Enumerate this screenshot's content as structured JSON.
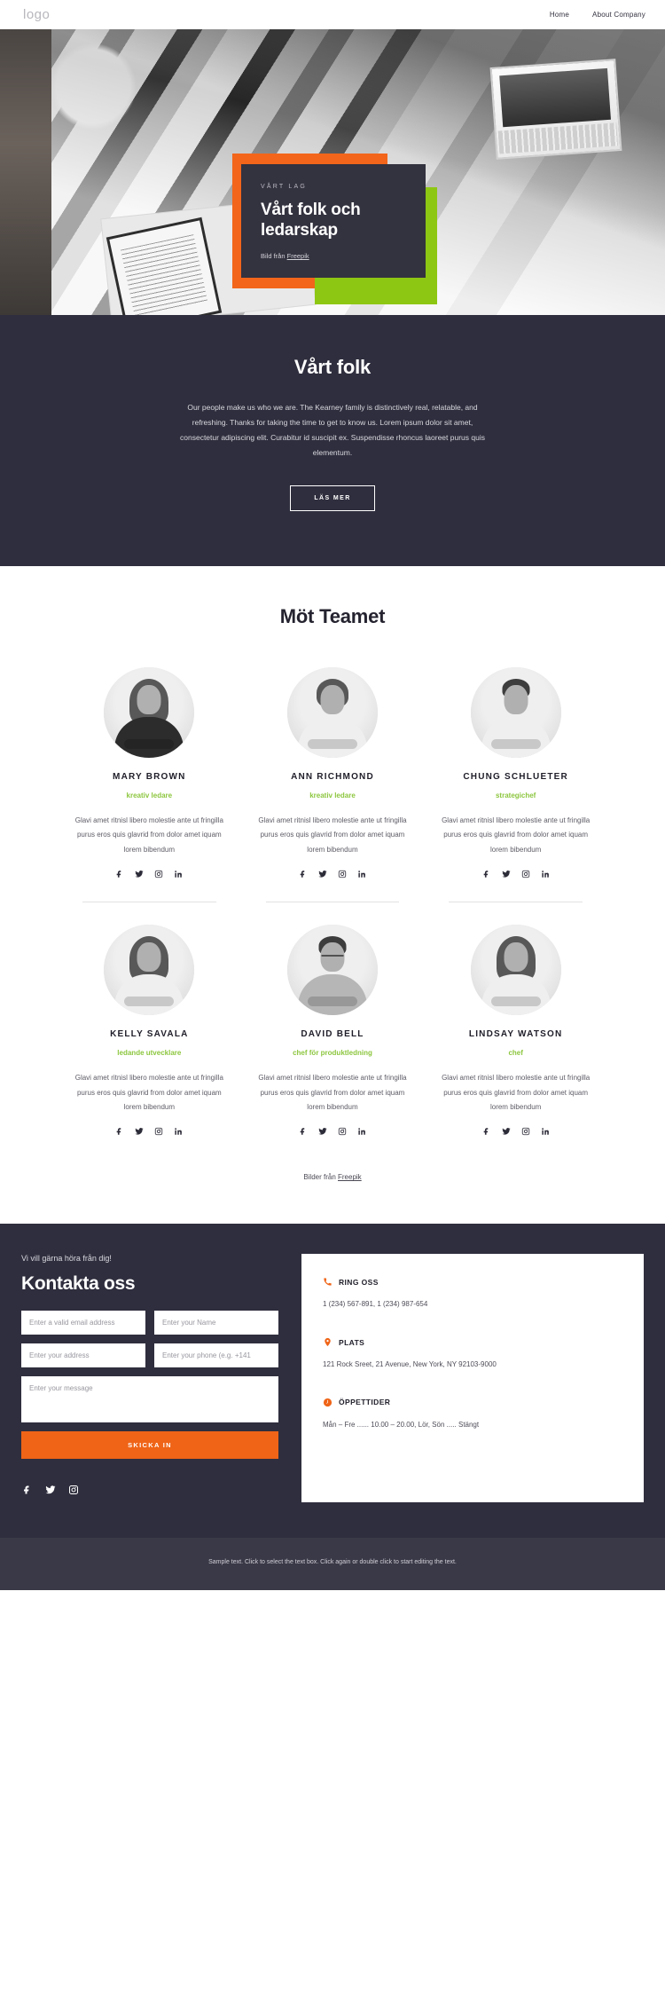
{
  "header": {
    "logo": "logo",
    "nav": [
      {
        "label": "Home"
      },
      {
        "label": "About Company"
      }
    ]
  },
  "hero": {
    "eyebrow": "VÅRT LAG",
    "title": "Vårt folk och ledarskap",
    "caption_prefix": "Bild från ",
    "caption_link": "Freepik",
    "accent_orange": "#f2651a",
    "accent_green": "#8ec713",
    "card_bg": "#33323f"
  },
  "intro": {
    "title": "Vårt folk",
    "text": "Our people make us who we are. The Kearney family is distinctively real, relatable, and refreshing. Thanks for taking the time to get to know us. Lorem ipsum dolor sit amet, consectetur adipiscing elit. Curabitur id suscipit ex. Suspendisse rhoncus laoreet purus quis elementum.",
    "button": "LÄS MER"
  },
  "team": {
    "title": "Möt Teamet",
    "role_color": "#8cc63e",
    "bio": "Glavi amet ritnisl libero molestie ante ut fringilla purus eros quis glavrid from dolor amet iquam lorem bibendum",
    "members": [
      {
        "name": "MARY BROWN",
        "role": "kreativ ledare"
      },
      {
        "name": "ANN RICHMOND",
        "role": "kreativ ledare"
      },
      {
        "name": "CHUNG SCHLUETER",
        "role": "strategichef"
      },
      {
        "name": "KELLY SAVALA",
        "role": "ledande utvecklare"
      },
      {
        "name": "DAVID BELL",
        "role": "chef för produktledning"
      },
      {
        "name": "LINDSAY WATSON",
        "role": "chef"
      }
    ],
    "socials": [
      "facebook-icon",
      "twitter-icon",
      "instagram-icon",
      "linkedin-icon"
    ],
    "credit_prefix": "Bilder från ",
    "credit_link": "Freepik"
  },
  "contact": {
    "eyebrow": "Vi vill gärna höra från dig!",
    "title": "Kontakta oss",
    "fields": {
      "email_placeholder": "Enter a valid email address",
      "name_placeholder": "Enter your Name",
      "address_placeholder": "Enter your address",
      "phone_placeholder": "Enter your phone (e.g. +141",
      "message_placeholder": "Enter your message"
    },
    "submit_label": "SKICKA IN",
    "accent": "#ef6417",
    "socials": [
      "facebook-icon",
      "twitter-icon",
      "instagram-icon"
    ],
    "info": [
      {
        "icon": "phone-icon",
        "label": "RING OSS",
        "value": "1 (234) 567-891, 1 (234) 987-654"
      },
      {
        "icon": "location-pin-icon",
        "label": "PLATS",
        "value": "121 Rock Sreet, 21 Avenue, New York, NY 92103-9000"
      },
      {
        "icon": "clock-icon",
        "label": "ÖPPETTIDER",
        "value": "Mån – Fre ...... 10.00 – 20.00, Lör, Sön ..... Stängt"
      }
    ]
  },
  "footer": {
    "text": "Sample text. Click to select the text box. Click again or double click to start editing the text."
  }
}
